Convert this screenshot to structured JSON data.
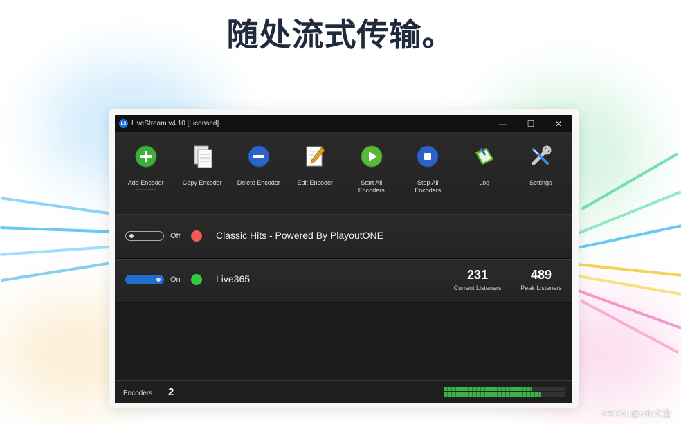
{
  "headline": "随处流式传输。",
  "window": {
    "title": "LiveStream v4.10 [Licensed]",
    "logo_text": "LS",
    "controls": {
      "minimize": "—",
      "maximize": "☐",
      "close": "✕"
    }
  },
  "toolbar": [
    {
      "label": "Add Encoder",
      "icon": "plus-circle-icon",
      "color": "#3fae3c"
    },
    {
      "label": "Copy Encoder",
      "icon": "copy-icon",
      "color": "#dddddd"
    },
    {
      "label": "Delete Encoder",
      "icon": "minus-circle-icon",
      "color": "#2d63c8"
    },
    {
      "label": "Edit Encoder",
      "icon": "edit-notepad-icon",
      "color": "#e6a020"
    },
    {
      "label": "Start All Encoders",
      "icon": "play-circle-icon",
      "color": "#5bb83a"
    },
    {
      "label": "Stop All Encoders",
      "icon": "stop-circle-icon",
      "color": "#2d63c8"
    },
    {
      "label": "Log",
      "icon": "log-book-icon",
      "color": "#6bbf4a"
    },
    {
      "label": "Settings",
      "icon": "wrench-screwdriver-icon",
      "color": "#3a8de0"
    }
  ],
  "encoders": [
    {
      "state": "Off",
      "on": false,
      "status_color": "#f25b55",
      "name": "Classic Hits - Powered By PlayoutONE"
    },
    {
      "state": "On",
      "on": true,
      "status_color": "#2ecc40",
      "name": "Live365",
      "current_listeners": "231",
      "current_listeners_label": "Current Listeners",
      "peak_listeners": "489",
      "peak_listeners_label": "Peak Listeners"
    }
  ],
  "status": {
    "encoders_label": "Encoders",
    "encoders_count": "2"
  },
  "audio_meters": [
    0.72,
    0.8
  ],
  "watermark": "CSDN @sdk大全"
}
